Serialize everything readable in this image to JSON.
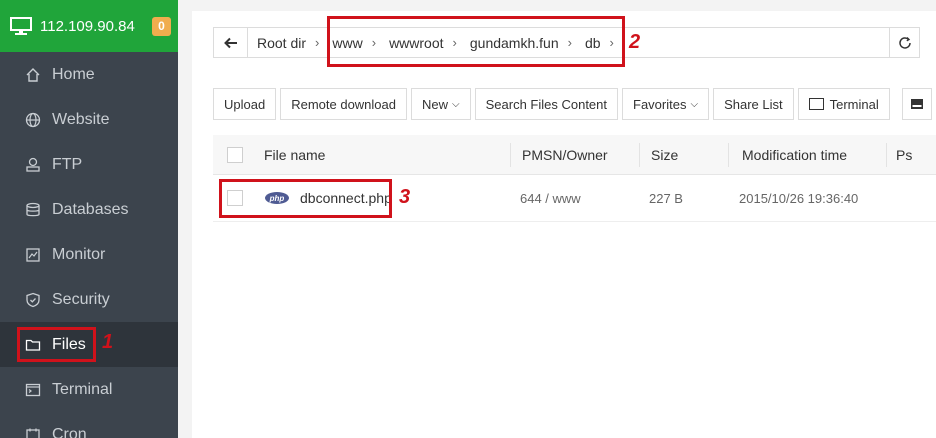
{
  "server": {
    "ip": "112.109.90.84",
    "badge": "0"
  },
  "sidebar": {
    "items": [
      {
        "label": "Home",
        "icon": "home-icon"
      },
      {
        "label": "Website",
        "icon": "globe-icon"
      },
      {
        "label": "FTP",
        "icon": "ftp-icon"
      },
      {
        "label": "Databases",
        "icon": "database-icon"
      },
      {
        "label": "Monitor",
        "icon": "monitor-icon"
      },
      {
        "label": "Security",
        "icon": "shield-icon"
      },
      {
        "label": "Files",
        "icon": "folder-icon",
        "active": true
      },
      {
        "label": "Terminal",
        "icon": "terminal-icon"
      },
      {
        "label": "Cron",
        "icon": "clock-icon"
      }
    ]
  },
  "path": {
    "crumbs": [
      "Root dir",
      "www",
      "wwwroot",
      "gundamkh.fun",
      "db"
    ]
  },
  "toolbar": {
    "upload": "Upload",
    "remote_download": "Remote download",
    "new": "New",
    "search": "Search Files Content",
    "favorites": "Favorites",
    "share_list": "Share List",
    "terminal": "Terminal"
  },
  "table": {
    "headers": {
      "file_name": "File name",
      "pmsn_owner": "PMSN/Owner",
      "size": "Size",
      "mod_time": "Modification time",
      "ps": "Ps"
    },
    "rows": [
      {
        "file_icon": "php",
        "name": "dbconnect.php",
        "pmsn_owner": "644 / www",
        "size": "227 B",
        "mod_time": "2015/10/26 19:36:40"
      }
    ]
  },
  "annotations": {
    "n1": "1",
    "n2": "2",
    "n3": "3"
  },
  "colors": {
    "sidebar_bg": "#3c444d",
    "server_bar": "#20a53a",
    "badge": "#f0ad4e",
    "annotation": "#d0121b"
  }
}
